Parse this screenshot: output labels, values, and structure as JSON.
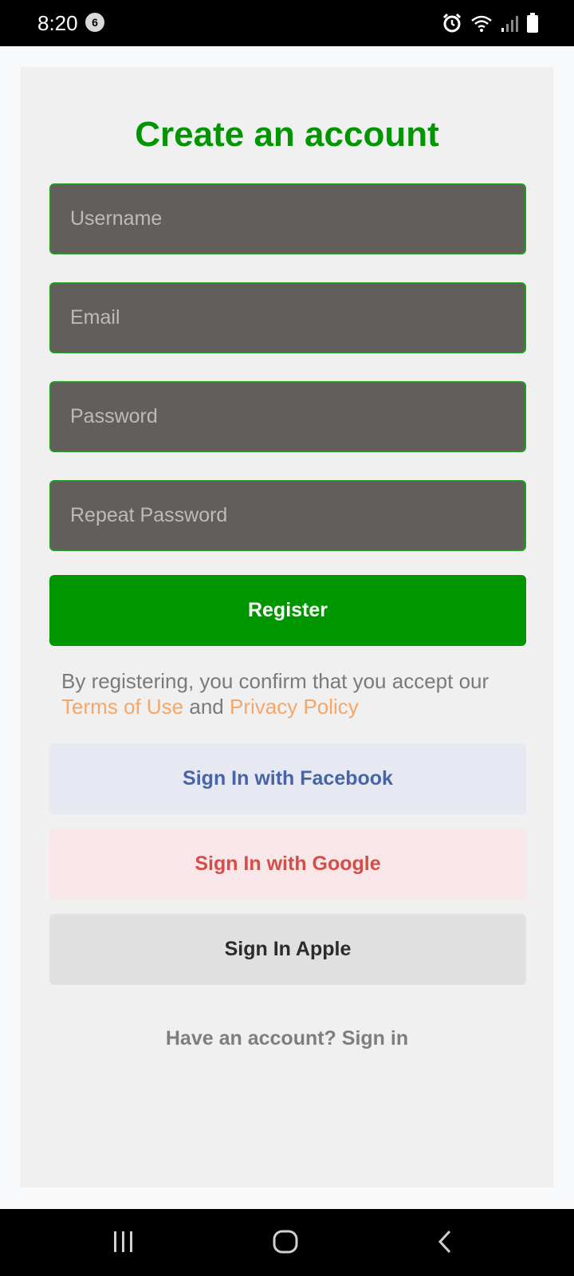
{
  "status_bar": {
    "time": "8:20",
    "notification_count": "6",
    "icons": [
      "alarm-icon",
      "wifi-icon",
      "signal-icon",
      "battery-icon"
    ]
  },
  "form": {
    "title": "Create an account",
    "fields": [
      {
        "name": "username",
        "placeholder": "Username",
        "value": ""
      },
      {
        "name": "email",
        "placeholder": "Email",
        "value": ""
      },
      {
        "name": "password",
        "placeholder": "Password",
        "value": ""
      },
      {
        "name": "repeat_password",
        "placeholder": "Repeat Password",
        "value": ""
      }
    ],
    "register_label": "Register",
    "terms": {
      "prefix": "By registering, you confirm that you accept our ",
      "terms_link": "Terms of Use",
      "middle": " and ",
      "privacy_link": "Privacy Policy"
    },
    "social": {
      "facebook_label": "Sign In with Facebook",
      "google_label": "Sign In with Google",
      "apple_label": "Sign In Apple"
    },
    "signin_prompt": "Have an account? Sign in"
  },
  "colors": {
    "accent": "#009600",
    "field_bg": "#625e5b",
    "link": "#f5a76a",
    "facebook": "#4664a6",
    "google": "#d44e48"
  },
  "nav_bar": {
    "icons": [
      "recent-apps-icon",
      "home-icon",
      "back-icon"
    ]
  }
}
